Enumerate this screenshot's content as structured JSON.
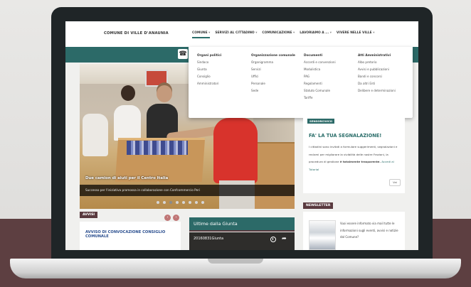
{
  "header": {
    "logo": "COMUNE DI VILLE D'ANAUNIA",
    "nav": [
      {
        "label": "COMUNE",
        "caret": "▾"
      },
      {
        "label": "SERVIZI AL CITTADINO",
        "caret": "▾"
      },
      {
        "label": "COMUNICAZIONE",
        "caret": "▾"
      },
      {
        "label": "LAVORIAMO A ...",
        "caret": "▾"
      },
      {
        "label": "VIVERE NELLE VILLE",
        "caret": "▾"
      }
    ]
  },
  "dropdown": {
    "columns": [
      {
        "title": "Organi politici",
        "items": [
          "Sindaco",
          "Giunta",
          "Consiglio",
          "Amministratori"
        ]
      },
      {
        "title": "Organizzazione comunale",
        "items": [
          "Organigramma",
          "Servizi",
          "Uffici",
          "Personale",
          "Sede"
        ]
      },
      {
        "title": "Documenti",
        "items": [
          "Accordi e convenzioni",
          "Modulistica",
          "PAG",
          "Regolamenti",
          "Statuto Comunale",
          "Tariffe"
        ]
      },
      {
        "title": "Atti Amministrativi",
        "items": [
          "Albo pretorio",
          "Avvisi e pubblicazioni",
          "Bandi e concorsi",
          "Da altri Enti",
          "Delibere e determinazioni"
        ]
      }
    ]
  },
  "slider": {
    "caption": "Due camion di aiuti per il Centro Italia",
    "subcaption": "Successo per l'iniziativa promossa in collaborazione con Confcommercio Peri"
  },
  "segnalazione": {
    "badge": "SENSORCIVICO",
    "title": "FA' LA TUA SEGNALAZIONE!",
    "text": "I cittadini sono invitati a formulare suggerimenti, segnalazioni e reclami per migliorare la vivibilità delle nostre Frazioni, la procedura di gestione",
    "text_bold": "è totalmente trasparente.",
    "link": "Accedi al Tutorial",
    "button": "Vai"
  },
  "newsletter": {
    "badge": "NEWSLETTER",
    "text": "Vuoi essere informato via mail tutte le informazioni sugli eventi, avvisi e notizie dal Comune?"
  },
  "avvisi": {
    "badge": "AVVISI",
    "prev": "‹",
    "next": "›",
    "title": "AVVISO DI CONVOCAZIONE CONSIGLIO COMUNALE"
  },
  "giunta": {
    "header": "Ultime dalla Giunta",
    "video_title": "20160831Giunta"
  },
  "icons": {
    "phone": "☎",
    "share": "➦"
  },
  "colors": {
    "teal": "#2c6a68",
    "maroon": "#5a3a3f",
    "link_blue": "#2b4f8f"
  }
}
